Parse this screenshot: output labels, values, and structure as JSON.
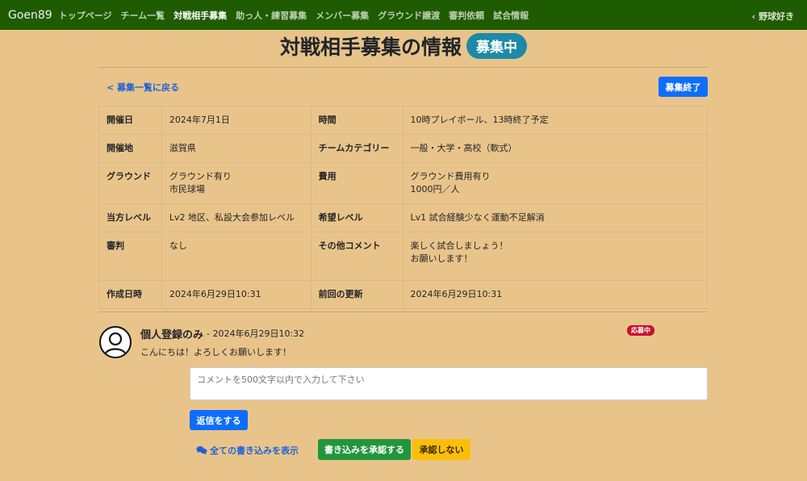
{
  "nav": {
    "brand": "Goen89",
    "items": [
      "トップページ",
      "チーム一覧",
      "対戦相手募集",
      "助っ人・練習募集",
      "メンバー募集",
      "グラウンド譲渡",
      "審判依頼",
      "試合情報"
    ],
    "active_index": 2,
    "user": "‹ 野球好き"
  },
  "header": {
    "title": "対戦相手募集の情報",
    "status": "募集中"
  },
  "actions": {
    "back": "< 募集一覧に戻る",
    "close": "募集終了"
  },
  "info": {
    "rows": [
      [
        {
          "k": "開催日",
          "v": [
            "2024年7月1日"
          ]
        },
        {
          "k": "時間",
          "v": [
            "10時プレイボール、13時終了予定"
          ]
        }
      ],
      [
        {
          "k": "開催地",
          "v": [
            "滋賀県"
          ]
        },
        {
          "k": "チームカテゴリー",
          "v": [
            "一般・大学・高校（軟式）"
          ]
        }
      ],
      [
        {
          "k": "グラウンド",
          "v": [
            "グラウンド有り",
            "市民球場"
          ]
        },
        {
          "k": "費用",
          "v": [
            "グラウンド費用有り",
            "1000円／人"
          ]
        }
      ],
      [
        {
          "k": "当方レベル",
          "v": [
            "Lv2 地区、私設大会参加レベル"
          ]
        },
        {
          "k": "希望レベル",
          "v": [
            "Lv1 試合経験少なく運動不足解消"
          ]
        }
      ],
      [
        {
          "k": "審判",
          "v": [
            "なし"
          ]
        },
        {
          "k": "その他コメント",
          "v": [
            "楽しく試合しましょう！",
            "お願いします！"
          ]
        }
      ],
      [
        {
          "k": "作成日時",
          "v": [
            "2024年6月29日10:31"
          ]
        },
        {
          "k": "前回の更新",
          "v": [
            "2024年6月29日10:31"
          ]
        }
      ]
    ]
  },
  "comment": {
    "author": "個人登録のみ",
    "date": "- 2024年6月29日10:32",
    "badge": "応募中",
    "text": "こんにちは！よろしくお願いします！"
  },
  "reply": {
    "placeholder": "コメントを500文字以内で入力して下さい",
    "submit": "返信をする",
    "show_all": "全ての書き込みを表示",
    "approve": "書き込みを承認する",
    "reject": "承認しない"
  }
}
